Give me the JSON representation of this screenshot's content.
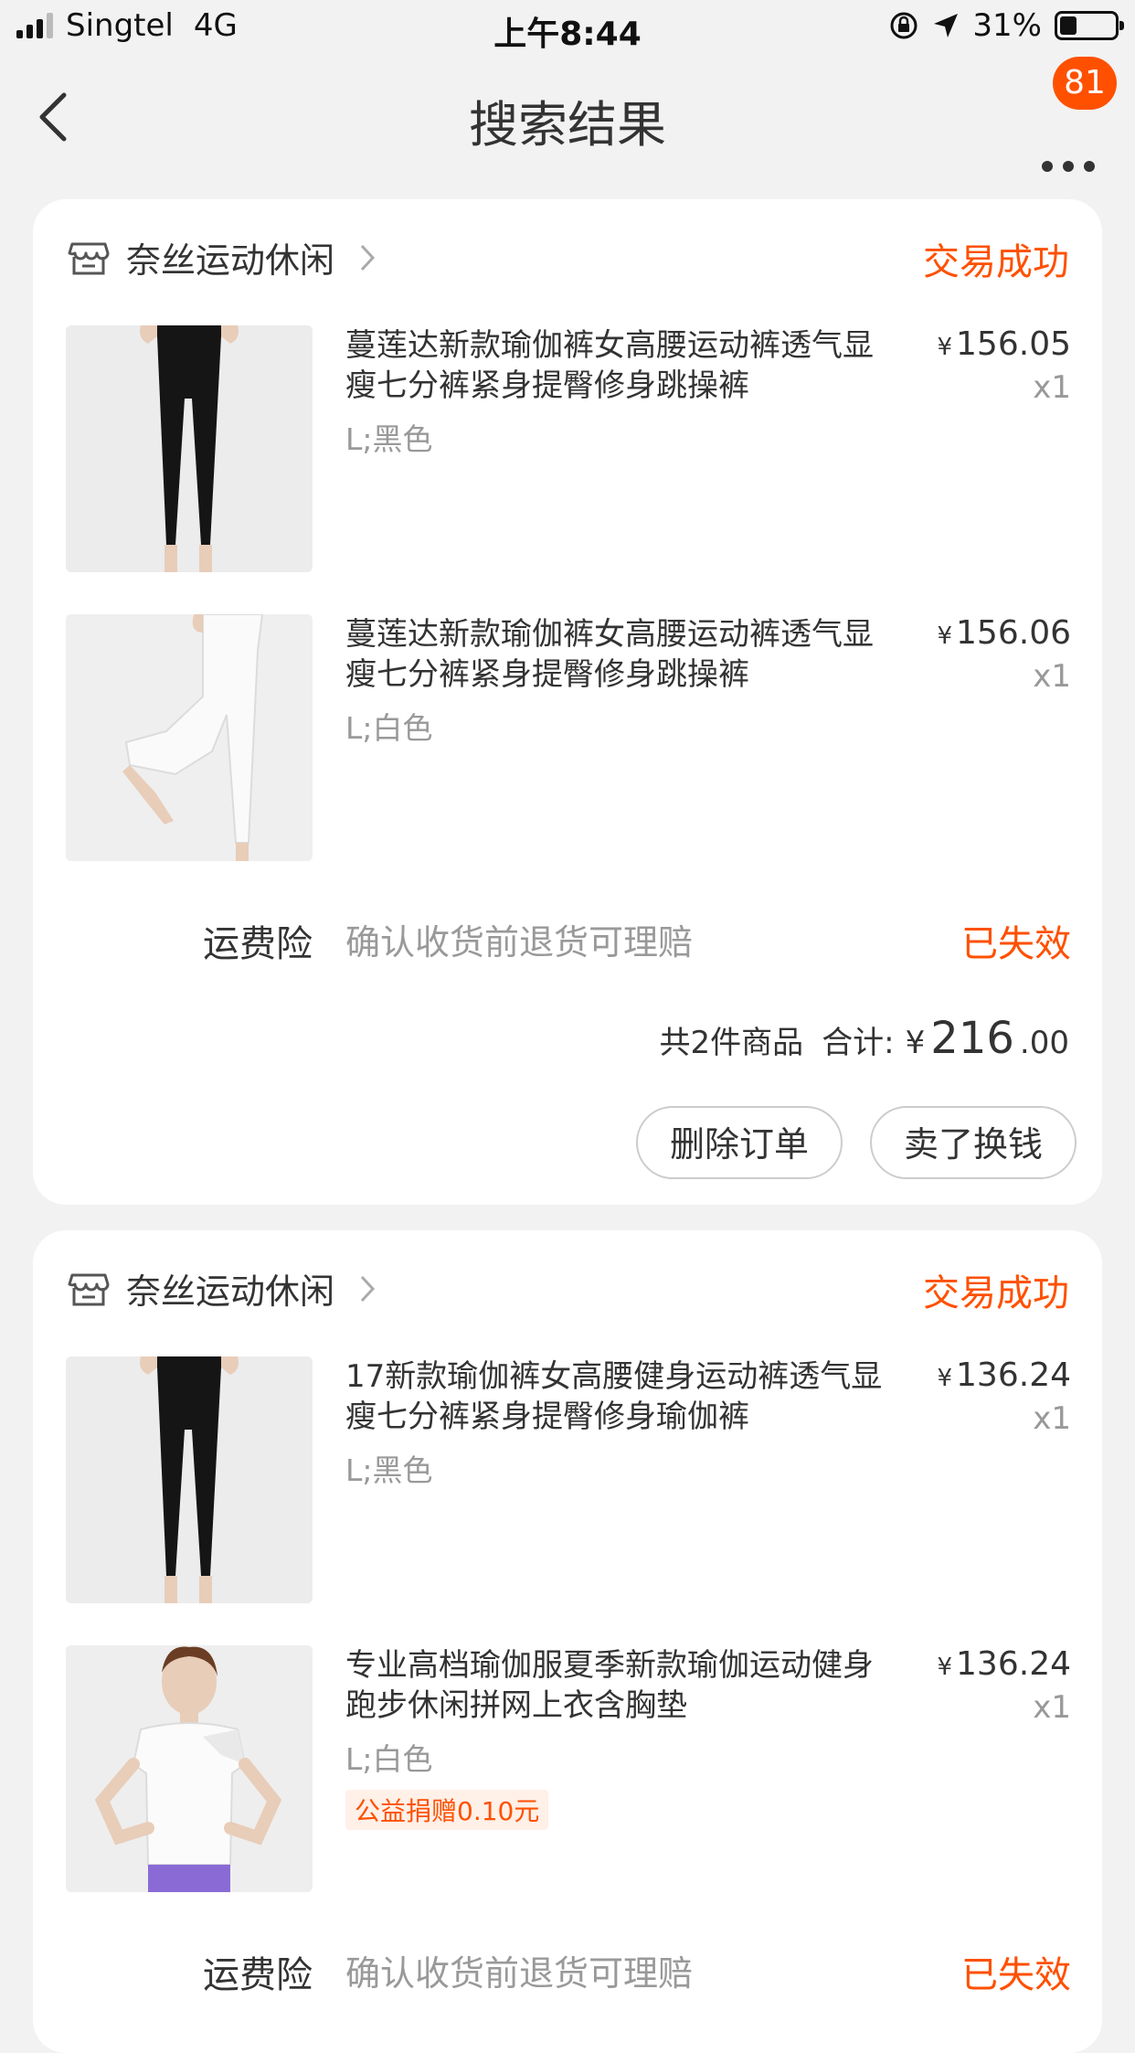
{
  "status_bar": {
    "carrier": "Singtel",
    "network": "4G",
    "time": "上午8:44",
    "battery": "31%",
    "battery_level": 0.31
  },
  "nav": {
    "title": "搜索结果",
    "badge": "81"
  },
  "colors": {
    "accent": "#ff5000",
    "muted": "#999999"
  },
  "orders": [
    {
      "shop_name": "奈丝运动休闲",
      "status": "交易成功",
      "items": [
        {
          "title": "蔓莲达新款瑜伽裤女高腰运动裤透气显瘦七分裤紧身提臀修身跳操裤",
          "spec": "L;黑色",
          "price_symbol": "¥",
          "price": "156.05",
          "qty": "x1",
          "image": "black-yoga-pants"
        },
        {
          "title": "蔓莲达新款瑜伽裤女高腰运动裤透气显瘦七分裤紧身提臀修身跳操裤",
          "spec": "L;白色",
          "price_symbol": "¥",
          "price": "156.06",
          "qty": "x1",
          "image": "white-yoga-pants"
        }
      ],
      "insurance": {
        "label": "运费险",
        "desc": "确认收货前退货可理赔",
        "status": "已失效"
      },
      "total": {
        "count_text": "共2件商品",
        "label": "合计:",
        "symbol": "¥",
        "int": "216",
        "dec": ".00"
      },
      "buttons": {
        "delete": "删除订单",
        "sell": "卖了换钱"
      }
    },
    {
      "shop_name": "奈丝运动休闲",
      "status": "交易成功",
      "items": [
        {
          "title": "17新款瑜伽裤女高腰健身运动裤透气显瘦七分裤紧身提臀修身瑜伽裤",
          "spec": "L;黑色",
          "price_symbol": "¥",
          "price": "136.24",
          "qty": "x1",
          "image": "black-yoga-pants"
        },
        {
          "title": "专业高档瑜伽服夏季新款瑜伽运动健身跑步休闲拼网上衣含胸垫",
          "spec": "L;白色",
          "price_symbol": "¥",
          "price": "136.24",
          "qty": "x1",
          "image": "white-yoga-top",
          "tag": "公益捐赠0.10元"
        }
      ],
      "insurance": {
        "label": "运费险",
        "desc": "确认收货前退货可理赔",
        "status": "已失效"
      }
    }
  ]
}
